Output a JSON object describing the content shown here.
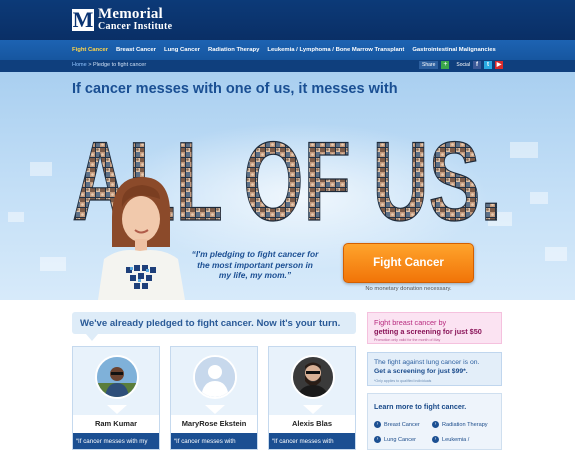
{
  "header": {
    "logo_mark": "M",
    "logo_line1": "Memorial",
    "logo_line2": "Cancer Institute"
  },
  "nav": {
    "items": [
      {
        "label": "Fight Cancer",
        "active": true
      },
      {
        "label": "Breast Cancer",
        "active": false
      },
      {
        "label": "Lung Cancer",
        "active": false
      },
      {
        "label": "Radiation Therapy",
        "active": false
      },
      {
        "label": "Leukemia / Lymphoma / Bone Marrow Transplant",
        "active": false
      },
      {
        "label": "Gastrointestinal Malignancies",
        "active": false
      }
    ]
  },
  "breadcrumb": {
    "home": "Home",
    "separator": " > ",
    "current": "Pledge to fight cancer"
  },
  "social": {
    "share_label": "Share",
    "social_label": "Social",
    "icons": [
      "facebook-icon",
      "twitter-icon",
      "youtube-icon"
    ]
  },
  "hero": {
    "headline": "If cancer messes with one of us, it messes with",
    "big_word": "ALL OF US.",
    "quote": "“I'm pledging to fight cancer for the most important person in my life, my mom.”",
    "cta_label": "Fight Cancer",
    "cta_note": "No monetary donation necessary."
  },
  "pledge": {
    "title": "We've already pledged to fight cancer. Now it's your turn.",
    "cards": [
      {
        "name": "Ram Kumar",
        "quote": "“If cancer messes with my"
      },
      {
        "name": "MaryRose Ekstein",
        "quote": "“If cancer messes with"
      },
      {
        "name": "Alexis Blas",
        "quote": "“If cancer messes with"
      }
    ]
  },
  "promos": {
    "breast": {
      "line1": "Fight breast cancer by",
      "line2": "getting a screening for just $50",
      "note": "Promotion only valid for the month of May"
    },
    "lung": {
      "line1": "The fight against lung cancer is on.",
      "line2": "Get a screening for just $99*.",
      "note": "*Only applies to qualified individuals"
    }
  },
  "learn": {
    "title": "Learn more to fight cancer.",
    "links": [
      "Breast Cancer",
      "Radiation Therapy",
      "Lung Cancer",
      "Leukemia /"
    ]
  },
  "colors": {
    "header_bg": "#0b3472",
    "nav_bg": "#1a5ea9",
    "active_nav": "#ffd54a",
    "headline": "#1a4f93",
    "cta": "#f58a17",
    "promo_pink": "#fbe3f2",
    "promo_blue": "#e3eef9"
  }
}
